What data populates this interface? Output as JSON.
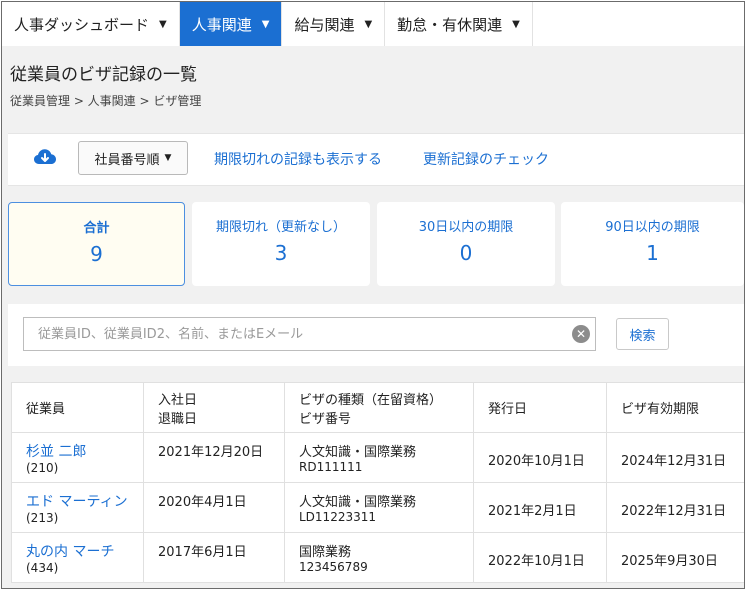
{
  "nav": {
    "tabs": [
      {
        "label": "人事ダッシュボード"
      },
      {
        "label": "人事関連"
      },
      {
        "label": "給与関連"
      },
      {
        "label": "勤怠・有休関連"
      }
    ]
  },
  "page": {
    "title": "従業員のビザ記録の一覧",
    "breadcrumb": "従業員管理 > 人事関連 > ビザ管理"
  },
  "toolbar": {
    "cloud_icon": "cloud-download-icon",
    "sort_label": "社員番号順",
    "show_expired_label": "期限切れの記録も表示する",
    "check_renewal_label": "更新記録のチェック"
  },
  "summary": [
    {
      "label": "合計",
      "value": "9"
    },
    {
      "label": "期限切れ（更新なし）",
      "value": "3"
    },
    {
      "label": "30日以内の期限",
      "value": "0"
    },
    {
      "label": "90日以内の期限",
      "value": "1"
    }
  ],
  "search": {
    "placeholder": "従業員ID、従業員ID2、名前、またはEメール",
    "value": "",
    "button_label": "検索",
    "clear_icon": "clear-icon"
  },
  "table": {
    "headers": {
      "employee": "従業員",
      "hire_date": "入社日",
      "leave_date": "退職日",
      "visa_type": "ビザの種類（在留資格）",
      "visa_number": "ビザ番号",
      "issue_date": "発行日",
      "expiry": "ビザ有効期限"
    },
    "rows": [
      {
        "name": "杉並 二郎",
        "id": "(210)",
        "hire_date": "2021年12月20日",
        "visa_type": "人文知識・国際業務",
        "visa_number": "RD111111",
        "issue_date": "2020年10月1日",
        "expiry": "2024年12月31日"
      },
      {
        "name": "エド マーティン",
        "id": "(213)",
        "hire_date": "2020年4月1日",
        "visa_type": "人文知識・国際業務",
        "visa_number": "LD11223311",
        "issue_date": "2021年2月1日",
        "expiry": "2022年12月31日"
      },
      {
        "name": "丸の内 マーチ",
        "id": "(434)",
        "hire_date": "2017年6月1日",
        "visa_type": "国際業務",
        "visa_number": "123456789",
        "issue_date": "2022年10月1日",
        "expiry": "2025年9月30日"
      }
    ]
  },
  "colors": {
    "accent": "#1b6fd2",
    "selected_card_bg": "#fffdf2",
    "background": "#f1f1f1"
  }
}
